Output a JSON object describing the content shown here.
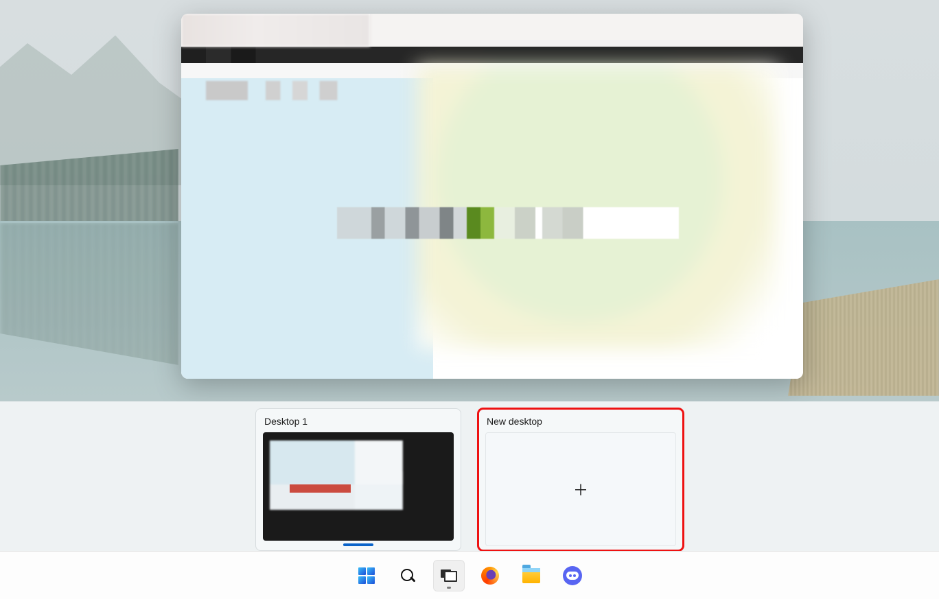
{
  "virtual_desktops": {
    "existing": [
      {
        "label": "Desktop 1"
      }
    ],
    "new_desktop_label": "New desktop"
  },
  "taskbar": {
    "items": [
      {
        "name": "start",
        "icon": "windows-start-icon"
      },
      {
        "name": "search",
        "icon": "search-icon"
      },
      {
        "name": "task-view",
        "icon": "task-view-icon",
        "active": true
      },
      {
        "name": "firefox",
        "icon": "firefox-icon"
      },
      {
        "name": "file-explorer",
        "icon": "file-explorer-icon"
      },
      {
        "name": "discord",
        "icon": "discord-icon"
      }
    ]
  },
  "highlight": {
    "target": "new-desktop-card",
    "color": "#e11"
  }
}
